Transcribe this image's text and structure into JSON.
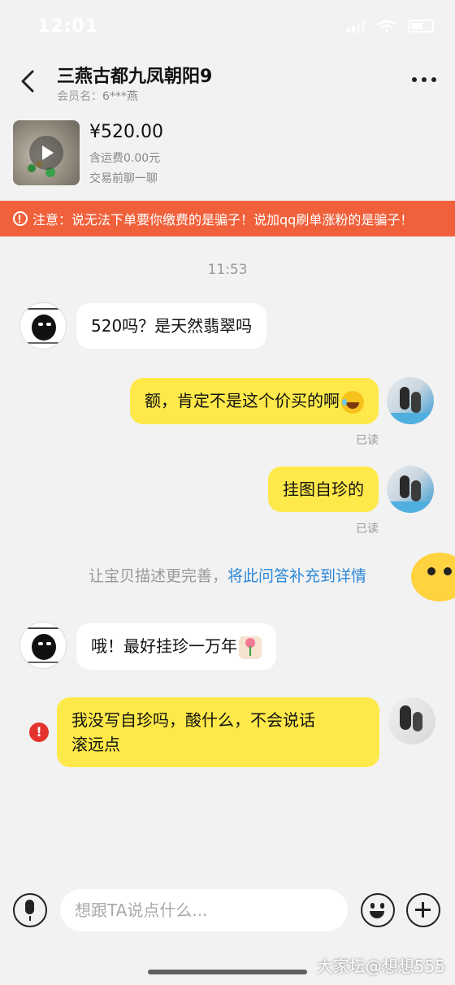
{
  "status_bar": {
    "time": "12:01"
  },
  "header": {
    "title": "三燕古都九凤朝阳9",
    "member_label": "会员名：",
    "member_name": "6***燕"
  },
  "product": {
    "price": "¥520.00",
    "shipping": "含运费0.00元",
    "chat_hint": "交易前聊一聊"
  },
  "warning": {
    "text": "注意：说无法下单要你缴费的是骗子！说加qq刷单涨粉的是骗子！"
  },
  "chat": {
    "timestamp": "11:53",
    "messages": [
      {
        "from": "seller",
        "text": "520吗？是天然翡翠吗"
      },
      {
        "from": "buyer",
        "text": "额，肯定不是这个价买的啊",
        "emoji": "laugh-tears",
        "status": "已读"
      },
      {
        "from": "buyer",
        "text": "挂图自珍的",
        "status": "已读"
      },
      {
        "from": "seller",
        "text": "哦！最好挂珍一万年",
        "emoji": "flower"
      },
      {
        "from": "buyer",
        "line1": "我没写自珍吗，酸什么，不会说话",
        "line2": "滚远点",
        "failed": true
      }
    ],
    "hint_prefix": "让宝贝描述更完善，",
    "hint_link": "将此问答补充到详情"
  },
  "input": {
    "placeholder": "想跟TA说点什么..."
  },
  "watermark": "大家坛@想想555",
  "colors": {
    "warning_bg": "#f0603a",
    "outgoing_bubble": "#ffe94a",
    "incoming_bubble": "#ffffff",
    "link": "#2b88d8",
    "error": "#e4322d"
  }
}
